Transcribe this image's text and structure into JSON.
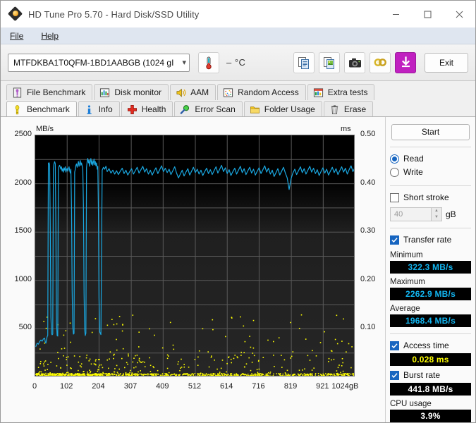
{
  "window": {
    "title": "HD Tune Pro 5.70 - Hard Disk/SSD Utility",
    "icon": "hdtune-app-icon",
    "minimize": "minimize-icon",
    "maximize": "maximize-icon",
    "close": "close-icon"
  },
  "menu": {
    "items": [
      "File",
      "Help"
    ]
  },
  "toolbar": {
    "drive": "MTFDKBA1T0QFM-1BD1AABGB (1024 gI",
    "temperature": "– °C",
    "buttons": [
      {
        "name": "temperature-icon",
        "glyph": "thermometer"
      },
      {
        "name": "copy-button",
        "glyph": "copy"
      },
      {
        "name": "copy-image-button",
        "glyph": "copy-image"
      },
      {
        "name": "screenshot-button",
        "glyph": "camera"
      },
      {
        "name": "settings-button",
        "glyph": "chain"
      },
      {
        "name": "save-button",
        "glyph": "down-arrow"
      }
    ],
    "exit_label": "Exit"
  },
  "tabs": {
    "row1": [
      {
        "label": "File Benchmark",
        "icon": "file-benchmark-icon",
        "active": false
      },
      {
        "label": "Disk monitor",
        "icon": "disk-monitor-icon",
        "active": false
      },
      {
        "label": "AAM",
        "icon": "aam-icon",
        "active": false
      },
      {
        "label": "Random Access",
        "icon": "random-access-icon",
        "active": false
      },
      {
        "label": "Extra tests",
        "icon": "extra-tests-icon",
        "active": false
      }
    ],
    "row2": [
      {
        "label": "Benchmark",
        "icon": "benchmark-icon",
        "active": true
      },
      {
        "label": "Info",
        "icon": "info-icon",
        "active": false
      },
      {
        "label": "Health",
        "icon": "health-icon",
        "active": false
      },
      {
        "label": "Error Scan",
        "icon": "error-scan-icon",
        "active": false
      },
      {
        "label": "Folder Usage",
        "icon": "folder-usage-icon",
        "active": false
      },
      {
        "label": "Erase",
        "icon": "erase-icon",
        "active": false
      }
    ]
  },
  "sidebar": {
    "start_label": "Start",
    "mode": {
      "read": "Read",
      "write": "Write",
      "selected": "Read"
    },
    "short_stroke": {
      "label": "Short stroke",
      "checked": false,
      "value": "40",
      "unit": "gB"
    },
    "transfer_rate": {
      "label": "Transfer rate",
      "checked": true
    },
    "minimum": {
      "label": "Minimum",
      "value": "322.3 MB/s",
      "color": "#12b5f0"
    },
    "maximum": {
      "label": "Maximum",
      "value": "2262.9 MB/s",
      "color": "#12b5f0"
    },
    "average": {
      "label": "Average",
      "value": "1968.4 MB/s",
      "color": "#12b5f0"
    },
    "access_time": {
      "label": "Access time",
      "checked": true,
      "value": "0.028 ms",
      "color": "#ffff00"
    },
    "burst_rate": {
      "label": "Burst rate",
      "checked": true,
      "value": "441.8 MB/s",
      "color": "#ffffff"
    },
    "cpu_usage": {
      "label": "CPU usage",
      "value": "3.9%",
      "color": "#ffffff"
    }
  },
  "chart_data": {
    "type": "line",
    "title": "",
    "xlabel": "1024gB",
    "ylabel": "MB/s",
    "y2label": "ms",
    "xlim": [
      0,
      1024
    ],
    "ylim": [
      0,
      2500
    ],
    "y2lim": [
      0,
      0.5
    ],
    "grid": true,
    "legend": "none",
    "xticks": [
      0,
      102,
      204,
      307,
      409,
      512,
      614,
      716,
      819,
      921,
      1024
    ],
    "xticklabels": [
      "0",
      "102",
      "204",
      "307",
      "409",
      "512",
      "614",
      "716",
      "819",
      "921",
      "1024gB"
    ],
    "yticks": [
      500,
      1000,
      1500,
      2000,
      2500
    ],
    "yticklabels": [
      "500",
      "1000",
      "1500",
      "2000",
      "2500"
    ],
    "y2ticks": [
      0.1,
      0.2,
      0.3,
      0.4,
      0.5
    ],
    "y2ticklabels": [
      "0.10",
      "0.20",
      "0.30",
      "0.40",
      "0.50"
    ],
    "series": [
      {
        "name": "Transfer rate",
        "color": "#1aa7e0",
        "axis": "left",
        "x": [
          2,
          6,
          10,
          14,
          18,
          22,
          26,
          30,
          32,
          34,
          36,
          38,
          40,
          42,
          44,
          46,
          48,
          50,
          52,
          54,
          56,
          58,
          60,
          62,
          64,
          66,
          68,
          70,
          72,
          74,
          76,
          78,
          80,
          82,
          84,
          86,
          88,
          90,
          92,
          94,
          96,
          98,
          100,
          102,
          104,
          106,
          108,
          110,
          112,
          114,
          116,
          118,
          120,
          122,
          124,
          126,
          128,
          130,
          132,
          134,
          136,
          138,
          140,
          142,
          144,
          146,
          148,
          150,
          152,
          154,
          156,
          158,
          160,
          162,
          164,
          166,
          168,
          170,
          172,
          174,
          176,
          178,
          180,
          182,
          184,
          186,
          188,
          190,
          192,
          194,
          196,
          198,
          200,
          202,
          204,
          206,
          210,
          214,
          218,
          222,
          226,
          230,
          236,
          242,
          248,
          254,
          260,
          266,
          272,
          278,
          284,
          290,
          296,
          302,
          308,
          314,
          320,
          326,
          332,
          338,
          344,
          350,
          356,
          362,
          368,
          374,
          380,
          386,
          392,
          398,
          404,
          410,
          416,
          422,
          428,
          434,
          440,
          446,
          452,
          458,
          464,
          470,
          476,
          482,
          488,
          494,
          500,
          506,
          512,
          518,
          524,
          530,
          536,
          542,
          548,
          554,
          560,
          566,
          572,
          578,
          584,
          590,
          596,
          602,
          608,
          614,
          620,
          626,
          632,
          638,
          644,
          650,
          656,
          662,
          668,
          674,
          680,
          686,
          692,
          698,
          704,
          710,
          716,
          722,
          728,
          734,
          740,
          746,
          752,
          758,
          764,
          770,
          776,
          782,
          788,
          794,
          800,
          806,
          812,
          818,
          824,
          830,
          836,
          842,
          848,
          854,
          860,
          866,
          872,
          878,
          884,
          890,
          896,
          902,
          908,
          914,
          920,
          926,
          932,
          938,
          944,
          950,
          956,
          962,
          968,
          974,
          980,
          986,
          992,
          998,
          1004,
          1010,
          1016,
          1022
        ],
        "y": [
          318,
          352,
          341,
          368,
          385,
          372,
          395,
          404,
          366,
          352,
          388,
          418,
          432,
          2210,
          2218,
          2195,
          1520,
          620,
          452,
          438,
          445,
          2160,
          2208,
          2228,
          2206,
          1480,
          560,
          430,
          425,
          2140,
          2180,
          2190,
          2170,
          2150,
          2175,
          2130,
          2155,
          2120,
          2165,
          2140,
          2175,
          2120,
          2145,
          2160,
          2130,
          2155,
          2175,
          2135,
          2110,
          2150,
          1760,
          900,
          520,
          445,
          452,
          2120,
          2150,
          2190,
          2205,
          2170,
          2200,
          2230,
          2180,
          2210,
          2240,
          2190,
          2215,
          2185,
          2160,
          1780,
          870,
          490,
          430,
          455,
          2165,
          2230,
          2262,
          2215,
          2245,
          2180,
          2230,
          2260,
          2200,
          2240,
          2190,
          2225,
          2255,
          2195,
          2230,
          2185,
          2215,
          2150,
          2180,
          1700,
          820,
          470,
          440,
          2140,
          2170,
          2150,
          2180,
          2125,
          2155,
          2110,
          2140,
          2100,
          2135,
          2095,
          2130,
          2160,
          2105,
          2140,
          2090,
          2125,
          2155,
          2100,
          2135,
          2170,
          2110,
          2145,
          2180,
          2120,
          2155,
          2100,
          2140,
          2090,
          2130,
          2165,
          2105,
          2145,
          2185,
          2125,
          2160,
          2115,
          2150,
          2095,
          2135,
          2175,
          2110,
          2060,
          2100,
          2140,
          2080,
          2120,
          2155,
          2090,
          2130,
          2170,
          2115,
          2150,
          2100,
          2140,
          2085,
          2125,
          2160,
          2105,
          2145,
          2095,
          2135,
          2175,
          2110,
          2150,
          2190,
          2125,
          2165,
          2105,
          2145,
          2085,
          2125,
          2160,
          2100,
          2140,
          2180,
          2115,
          2155,
          2095,
          2135,
          2170,
          2110,
          2150,
          2090,
          2130,
          2165,
          2105,
          2145,
          2185,
          2120,
          2160,
          2100,
          2140,
          2075,
          2115,
          2155,
          2090,
          2130,
          2170,
          2110,
          2060,
          1940,
          2050,
          2110,
          2150,
          2095,
          2135,
          2175,
          2115,
          2155,
          2100,
          2140,
          2180,
          2120,
          2160,
          2105,
          2145,
          2085,
          2125,
          2165,
          2110,
          2150,
          2090,
          2130,
          2170,
          2115,
          2155,
          2095,
          2135,
          2175,
          2120,
          2160,
          2100,
          2145,
          2185,
          2125,
          2165,
          2105,
          2150,
          2190,
          2130,
          2170,
          2110
        ]
      },
      {
        "name": "Access time",
        "color": "#ffff00",
        "axis": "right",
        "style": "scatter",
        "description": "Dense cluster of access-time samples near 0.005-0.02 ms along the bottom of the plot, with scattered outliers up to ~0.12 ms, densest between 0 and 300 gB."
      }
    ]
  }
}
